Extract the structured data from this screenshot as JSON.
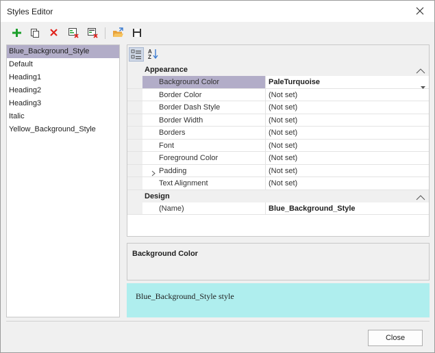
{
  "window": {
    "title": "Styles Editor"
  },
  "toolbar": {
    "buttons": [
      {
        "icon": "add-icon"
      },
      {
        "icon": "copy-icon"
      },
      {
        "icon": "delete-icon"
      },
      {
        "icon": "clear-style-icon"
      },
      {
        "icon": "clear-all-styles-icon"
      },
      {
        "icon": "open-folder-icon"
      },
      {
        "icon": "save-icon"
      }
    ]
  },
  "styles": {
    "items": [
      "Blue_Background_Style",
      "Default",
      "Heading1",
      "Heading2",
      "Heading3",
      "Italic",
      "Yellow_Background_Style"
    ],
    "selected": "Blue_Background_Style"
  },
  "property_grid": {
    "toolbar": [
      {
        "icon": "categorized-icon",
        "active": true
      },
      {
        "icon": "sort-alphabetical-icon",
        "active": false
      }
    ],
    "categories": [
      {
        "label": "Appearance",
        "rows": [
          {
            "name": "Background Color",
            "value": "PaleTurquoise",
            "selected": true,
            "expandable": false
          },
          {
            "name": "Border Color",
            "value": "(Not set)",
            "selected": false,
            "expandable": false
          },
          {
            "name": "Border Dash Style",
            "value": "(Not set)",
            "selected": false,
            "expandable": false
          },
          {
            "name": "Border Width",
            "value": "(Not set)",
            "selected": false,
            "expandable": false
          },
          {
            "name": "Borders",
            "value": "(Not set)",
            "selected": false,
            "expandable": false
          },
          {
            "name": "Font",
            "value": "(Not set)",
            "selected": false,
            "expandable": false
          },
          {
            "name": "Foreground Color",
            "value": "(Not set)",
            "selected": false,
            "expandable": false
          },
          {
            "name": "Padding",
            "value": "(Not set)",
            "selected": false,
            "expandable": true
          },
          {
            "name": "Text Alignment",
            "value": "(Not set)",
            "selected": false,
            "expandable": false
          }
        ]
      },
      {
        "label": "Design",
        "rows": [
          {
            "name": "(Name)",
            "value": "Blue_Background_Style",
            "selected": false,
            "expandable": false,
            "bold": true
          }
        ]
      }
    ]
  },
  "description": {
    "title": "Background Color"
  },
  "preview": {
    "text": "Blue_Background_Style style",
    "background": "#afeeee"
  },
  "footer": {
    "close_label": "Close"
  },
  "colors": {
    "selection": "#b2adc8",
    "add_green": "#1d9f2c",
    "delete_red": "#e0231c",
    "folder_orange": "#e8a23a"
  }
}
